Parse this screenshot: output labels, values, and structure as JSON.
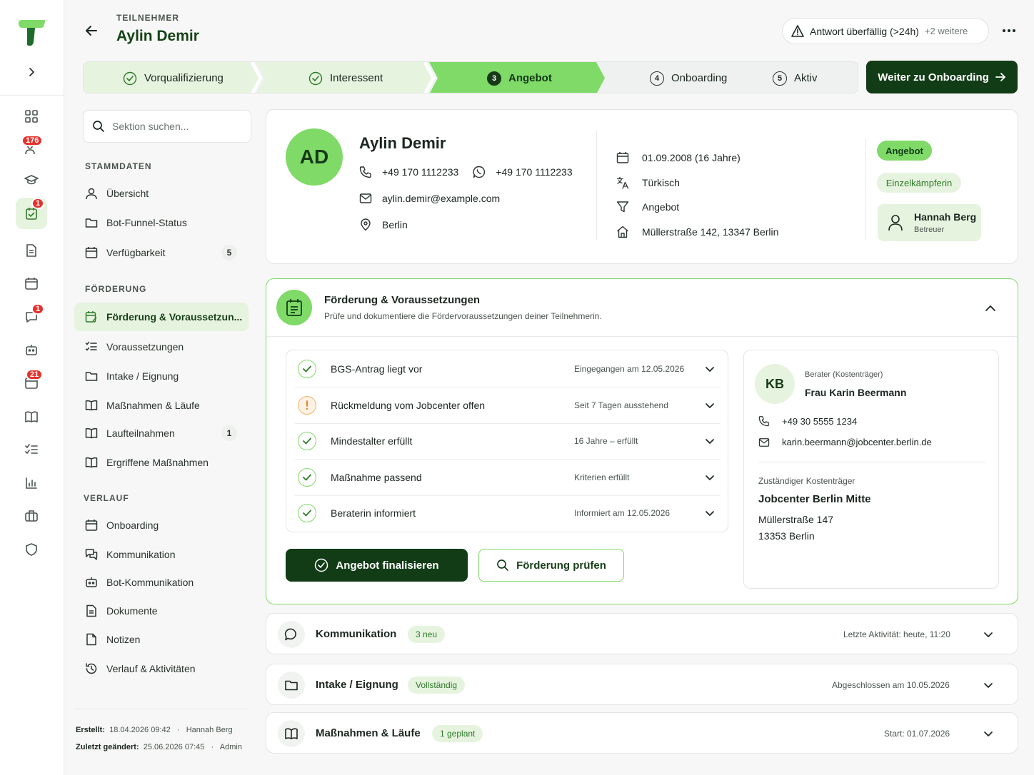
{
  "app": {
    "brand_color": "#7fda68",
    "dark_color": "#123c16",
    "rail_badges": {
      "community": "176",
      "tasks": "1",
      "chat": "1",
      "calendar": "21"
    }
  },
  "header": {
    "eyebrow": "TEILNEHMER",
    "name": "Aylin Demir",
    "alert_label": "Antwort überfällig (>24h)",
    "alert_more": "+2 weitere"
  },
  "stepper": {
    "steps": [
      {
        "label": "Vorqualifizierung",
        "state": "done"
      },
      {
        "label": "Interessent",
        "state": "done"
      },
      {
        "num": "3",
        "label": "Angebot",
        "state": "current"
      },
      {
        "num": "4",
        "label": "Onboarding",
        "state": "todo"
      },
      {
        "num": "5",
        "label": "Aktiv",
        "state": "todo"
      }
    ],
    "next_button": "Weiter zu Onboarding"
  },
  "nav": {
    "search_placeholder": "Sektion suchen...",
    "sections": [
      {
        "title": "STAMMDATEN",
        "items": [
          {
            "label": "Übersicht",
            "icon": "user-icon"
          },
          {
            "label": "Bot-Funnel-Status",
            "icon": "folder-icon"
          },
          {
            "label": "Verfügbarkeit",
            "icon": "calendar-icon",
            "count": "5"
          }
        ]
      },
      {
        "title": "FÖRDERUNG",
        "items": [
          {
            "label": "Förderung & Voraussetzun...",
            "icon": "calendar-edit-icon",
            "active": true
          },
          {
            "label": "Voraussetzungen",
            "icon": "checklist-icon"
          },
          {
            "label": "Intake / Eignung",
            "icon": "folder-icon"
          },
          {
            "label": "Maßnahmen & Läufe",
            "icon": "book-icon"
          },
          {
            "label": "Laufteilnahmen",
            "icon": "book-icon",
            "count": "1"
          },
          {
            "label": "Ergriffene Maßnahmen",
            "icon": "book-icon"
          }
        ]
      },
      {
        "title": "VERLAUF",
        "items": [
          {
            "label": "Onboarding",
            "icon": "calendar-icon"
          },
          {
            "label": "Kommunikation",
            "icon": "chat-icon"
          },
          {
            "label": "Bot-Kommunikation",
            "icon": "bot-icon"
          },
          {
            "label": "Dokumente",
            "icon": "document-icon"
          },
          {
            "label": "Notizen",
            "icon": "note-icon"
          },
          {
            "label": "Verlauf & Aktivitäten",
            "icon": "history-icon"
          }
        ]
      }
    ],
    "meta": {
      "created_label": "Erstellt:",
      "created_value": "18.04.2026 09:42",
      "created_by": "Hannah Berg",
      "changed_label": "Zuletzt geändert:",
      "changed_value": "25.06.2026 07:45",
      "changed_by": "Admin"
    }
  },
  "profile": {
    "initials": "AD",
    "name": "Aylin Demir",
    "phone": "+49 170 1112233",
    "whatsapp": "+49 170 1112233",
    "email": "aylin.demir@example.com",
    "city": "Berlin",
    "birth": "01.09.2008 (16 Jahre)",
    "language": "Türkisch",
    "funnel": "Angebot",
    "address": "Müllerstraße 142, 13347 Berlin",
    "status_tag": "Angebot",
    "type_tag": "Einzelkämpferin",
    "advisor_name": "Hannah Berg",
    "advisor_role": "Betreuer"
  },
  "foerderung": {
    "title": "Förderung & Voraussetzungen",
    "subtitle": "Prüfe und dokumentiere die Fördervoraussetzungen deiner Teilnehmerin.",
    "checks": [
      {
        "label": "BGS-Antrag liegt vor",
        "status": "Eingegangen am 12.05.2026",
        "state": "ok"
      },
      {
        "label": "Rückmeldung vom Jobcenter offen",
        "status": "Seit 7 Tagen ausstehend",
        "state": "warn"
      },
      {
        "label": "Mindestalter erfüllt",
        "status": "16 Jahre – erfüllt",
        "state": "ok"
      },
      {
        "label": "Maßnahme passend",
        "status": "Kriterien erfüllt",
        "state": "ok"
      },
      {
        "label": "Beraterin informiert",
        "status": "Informiert am 12.05.2026",
        "state": "ok"
      }
    ],
    "primary_button": "Angebot finalisieren",
    "secondary_button": "Förderung prüfen",
    "berater": {
      "initials": "KB",
      "role": "Berater (Kostenträger)",
      "name": "Frau Karin Beermann",
      "phone": "+49 30 5555 1234",
      "email": "karin.beermann@jobcenter.berlin.de",
      "org_label": "Zuständiger Kostenträger",
      "org_name": "Jobcenter Berlin Mitte",
      "street": "Müllerstraße 147",
      "city": "13353 Berlin"
    }
  },
  "sections": [
    {
      "title": "Kommunikation",
      "tag": "3 neu",
      "right": "Letzte Aktivität: heute, 11:20"
    },
    {
      "title": "Intake / Eignung",
      "tag": "Vollständig",
      "right": "Abgeschlossen am 10.05.2026"
    },
    {
      "title": "Maßnahmen & Läufe",
      "tag": "1 geplant",
      "right": "Start: 01.07.2026"
    }
  ]
}
